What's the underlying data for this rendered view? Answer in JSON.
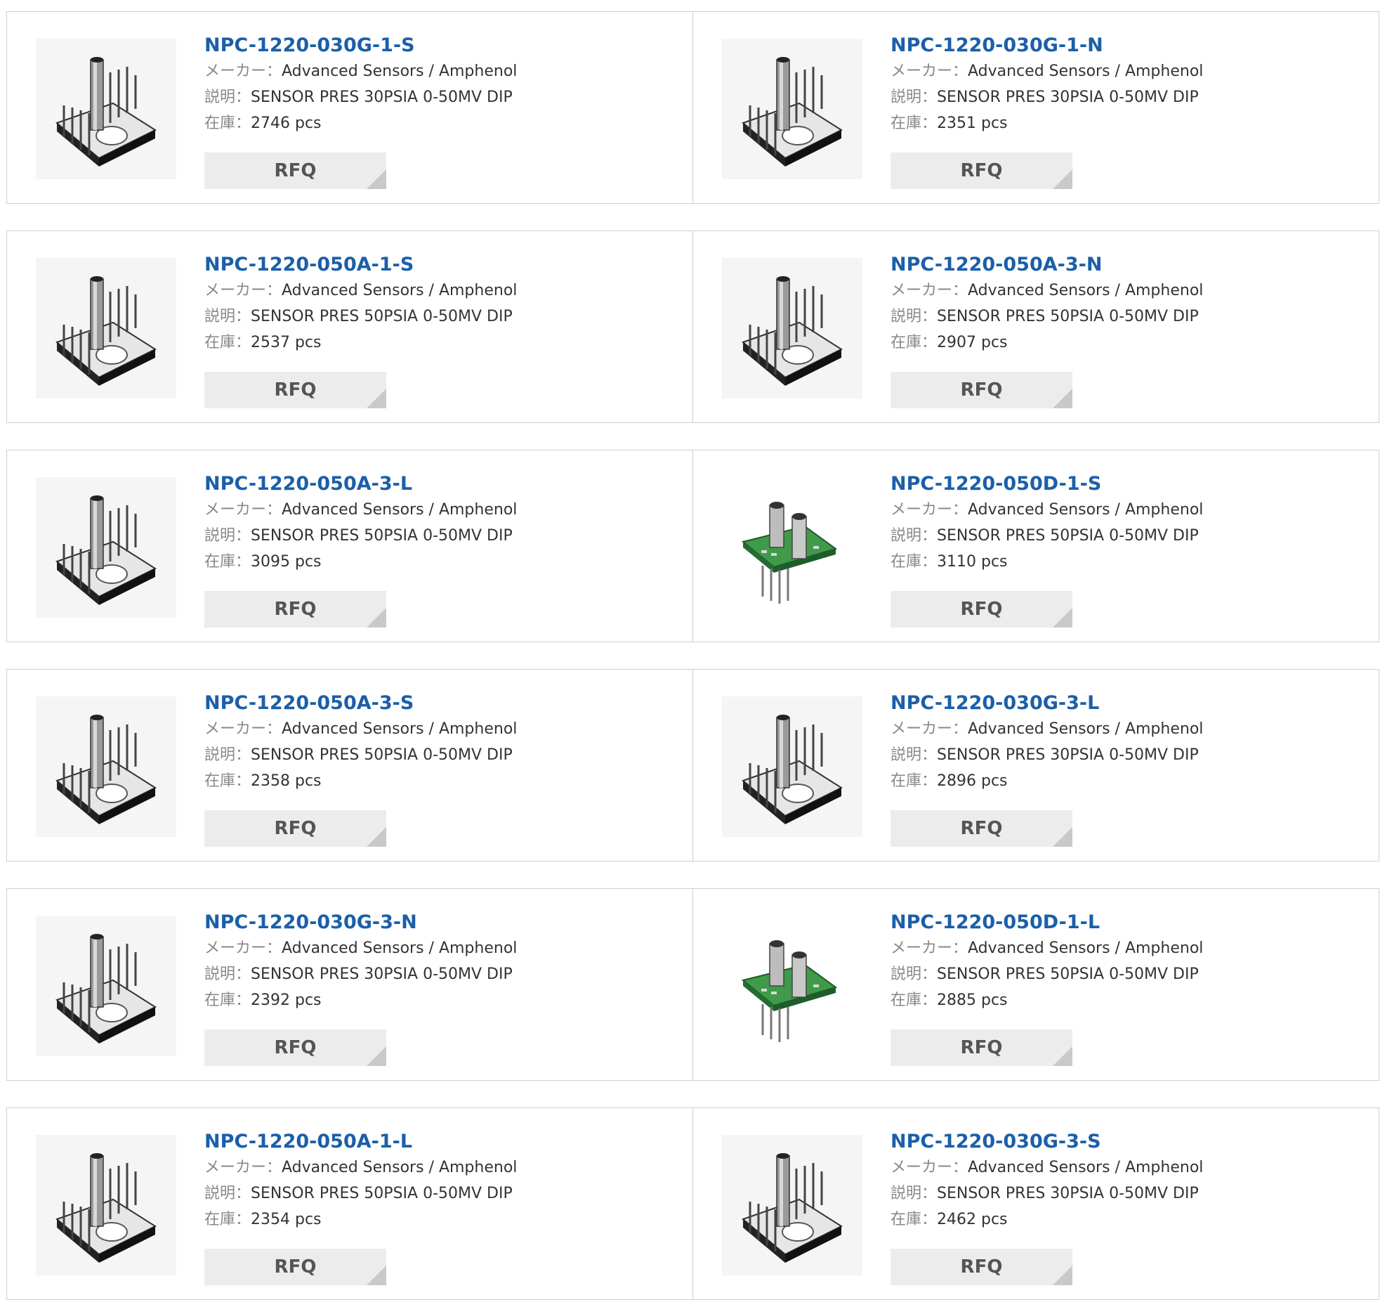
{
  "labels": {
    "manufacturer": "メーカー：",
    "description": "説明：",
    "stock": "在庫："
  },
  "products": [
    {
      "part": "NPC-1220-030G-1-S",
      "manufacturer": "Advanced Sensors / Amphenol",
      "description": "SENSOR PRES 30PSIA 0-50MV DIP",
      "stock": "2746 pcs",
      "rfq": "RFQ",
      "image": "sensor-dip-icon"
    },
    {
      "part": "NPC-1220-030G-1-N",
      "manufacturer": "Advanced Sensors / Amphenol",
      "description": "SENSOR PRES 30PSIA 0-50MV DIP",
      "stock": "2351 pcs",
      "rfq": "RFQ",
      "image": "sensor-dip-icon"
    },
    {
      "part": "NPC-1220-050A-1-S",
      "manufacturer": "Advanced Sensors / Amphenol",
      "description": "SENSOR PRES 50PSIA 0-50MV DIP",
      "stock": "2537 pcs",
      "rfq": "RFQ",
      "image": "sensor-dip-icon"
    },
    {
      "part": "NPC-1220-050A-3-N",
      "manufacturer": "Advanced Sensors / Amphenol",
      "description": "SENSOR PRES 50PSIA 0-50MV DIP",
      "stock": "2907 pcs",
      "rfq": "RFQ",
      "image": "sensor-dip-icon"
    },
    {
      "part": "NPC-1220-050A-3-L",
      "manufacturer": "Advanced Sensors / Amphenol",
      "description": "SENSOR PRES 50PSIA 0-50MV DIP",
      "stock": "3095 pcs",
      "rfq": "RFQ",
      "image": "sensor-dip-icon"
    },
    {
      "part": "NPC-1220-050D-1-S",
      "manufacturer": "Advanced Sensors / Amphenol",
      "description": "SENSOR PRES 50PSIA 0-50MV DIP",
      "stock": "3110 pcs",
      "rfq": "RFQ",
      "image": "sensor-pcb-icon"
    },
    {
      "part": "NPC-1220-050A-3-S",
      "manufacturer": "Advanced Sensors / Amphenol",
      "description": "SENSOR PRES 50PSIA 0-50MV DIP",
      "stock": "2358 pcs",
      "rfq": "RFQ",
      "image": "sensor-dip-icon"
    },
    {
      "part": "NPC-1220-030G-3-L",
      "manufacturer": "Advanced Sensors / Amphenol",
      "description": "SENSOR PRES 30PSIA 0-50MV DIP",
      "stock": "2896 pcs",
      "rfq": "RFQ",
      "image": "sensor-dip-icon"
    },
    {
      "part": "NPC-1220-030G-3-N",
      "manufacturer": "Advanced Sensors / Amphenol",
      "description": "SENSOR PRES 30PSIA 0-50MV DIP",
      "stock": "2392 pcs",
      "rfq": "RFQ",
      "image": "sensor-dip-icon"
    },
    {
      "part": "NPC-1220-050D-1-L",
      "manufacturer": "Advanced Sensors / Amphenol",
      "description": "SENSOR PRES 50PSIA 0-50MV DIP",
      "stock": "2885 pcs",
      "rfq": "RFQ",
      "image": "sensor-pcb-icon"
    },
    {
      "part": "NPC-1220-050A-1-L",
      "manufacturer": "Advanced Sensors / Amphenol",
      "description": "SENSOR PRES 50PSIA 0-50MV DIP",
      "stock": "2354 pcs",
      "rfq": "RFQ",
      "image": "sensor-dip-icon"
    },
    {
      "part": "NPC-1220-030G-3-S",
      "manufacturer": "Advanced Sensors / Amphenol",
      "description": "SENSOR PRES 30PSIA 0-50MV DIP",
      "stock": "2462 pcs",
      "rfq": "RFQ",
      "image": "sensor-dip-icon"
    }
  ],
  "colors": {
    "link": "#1b5fa8",
    "label": "#888888",
    "value": "#333333",
    "button_bg": "#ececec",
    "border": "#cfcfcf",
    "pcb_green": "#3f9a4a"
  }
}
